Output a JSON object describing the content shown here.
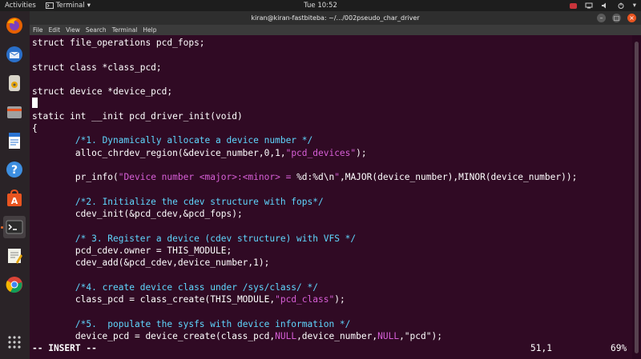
{
  "topbar": {
    "activities": "Activities",
    "app_menu": "Terminal",
    "clock": "Tue 10:52"
  },
  "window": {
    "title": "kiran@kiran-fastbiteba: ~/.../002pseudo_char_driver",
    "menu": [
      "File",
      "Edit",
      "View",
      "Search",
      "Terminal",
      "Help"
    ]
  },
  "dock": {
    "items": [
      "firefox-icon",
      "thunderbird-icon",
      "rhythmbox-icon",
      "files-icon",
      "libreoffice-writer-icon",
      "help-icon",
      "software-center-icon",
      "terminal-icon",
      "text-editor-icon",
      "chrome-icon",
      "show-applications-icon"
    ]
  },
  "code": {
    "lines": [
      [
        {
          "t": "struct file_operations pcd_fops;",
          "c": ""
        }
      ],
      [
        {
          "t": "",
          "c": ""
        }
      ],
      [
        {
          "t": "struct class *class_pcd;",
          "c": ""
        }
      ],
      [
        {
          "t": "",
          "c": ""
        }
      ],
      [
        {
          "t": "struct device *device_pcd;",
          "c": ""
        }
      ],
      [
        {
          "t": "",
          "c": "cursor"
        }
      ],
      [
        {
          "t": "static int __init pcd_driver_init(void)",
          "c": ""
        }
      ],
      [
        {
          "t": "{",
          "c": ""
        }
      ],
      [
        {
          "t": "        ",
          "c": ""
        },
        {
          "t": "/*1. Dynamically allocate a device number */",
          "c": "cm"
        }
      ],
      [
        {
          "t": "        alloc_chrdev_region(&device_number,0,1,",
          "c": ""
        },
        {
          "t": "\"pcd_devices\"",
          "c": "st"
        },
        {
          "t": ");",
          "c": ""
        }
      ],
      [
        {
          "t": "",
          "c": ""
        }
      ],
      [
        {
          "t": "        pr_info(",
          "c": ""
        },
        {
          "t": "\"Device number <major>:<minor> = ",
          "c": "st"
        },
        {
          "t": "%d:%d\\n",
          "c": ""
        },
        {
          "t": "\"",
          "c": "st"
        },
        {
          "t": ",MAJOR(device_number),MINOR(device_number));",
          "c": ""
        }
      ],
      [
        {
          "t": "",
          "c": ""
        }
      ],
      [
        {
          "t": "        ",
          "c": ""
        },
        {
          "t": "/*2. Initialize the cdev structure with fops*/",
          "c": "cm"
        }
      ],
      [
        {
          "t": "        cdev_init(&pcd_cdev,&pcd_fops);",
          "c": ""
        }
      ],
      [
        {
          "t": "",
          "c": ""
        }
      ],
      [
        {
          "t": "        ",
          "c": ""
        },
        {
          "t": "/* 3. Register a device (cdev structure) with VFS */",
          "c": "cm"
        }
      ],
      [
        {
          "t": "        pcd_cdev.owner = THIS_MODULE;",
          "c": ""
        }
      ],
      [
        {
          "t": "        cdev_add(&pcd_cdev,device_number,1);",
          "c": ""
        }
      ],
      [
        {
          "t": "",
          "c": ""
        }
      ],
      [
        {
          "t": "        ",
          "c": ""
        },
        {
          "t": "/*4. create device class under /sys/class/ */",
          "c": "cm"
        }
      ],
      [
        {
          "t": "        class_pcd = class_create(THIS_MODULE,",
          "c": ""
        },
        {
          "t": "\"pcd_class\"",
          "c": "st"
        },
        {
          "t": ");",
          "c": ""
        }
      ],
      [
        {
          "t": "",
          "c": ""
        }
      ],
      [
        {
          "t": "        ",
          "c": ""
        },
        {
          "t": "/*5.  populate the sysfs with device information */",
          "c": "cm"
        }
      ],
      [
        {
          "t": "        device_pcd = device_create(class_pcd,",
          "c": ""
        },
        {
          "t": "NULL",
          "c": "st"
        },
        {
          "t": ",device_number,",
          "c": ""
        },
        {
          "t": "NULL",
          "c": "st"
        },
        {
          "t": ",\"pcd\");",
          "c": ""
        }
      ]
    ]
  },
  "statusline": {
    "mode": "-- INSERT --",
    "position": "51,1",
    "percent": "69%"
  },
  "colors": {
    "background": "#300a24",
    "comment": "#5fd7ff",
    "string": "#d75fd7"
  }
}
